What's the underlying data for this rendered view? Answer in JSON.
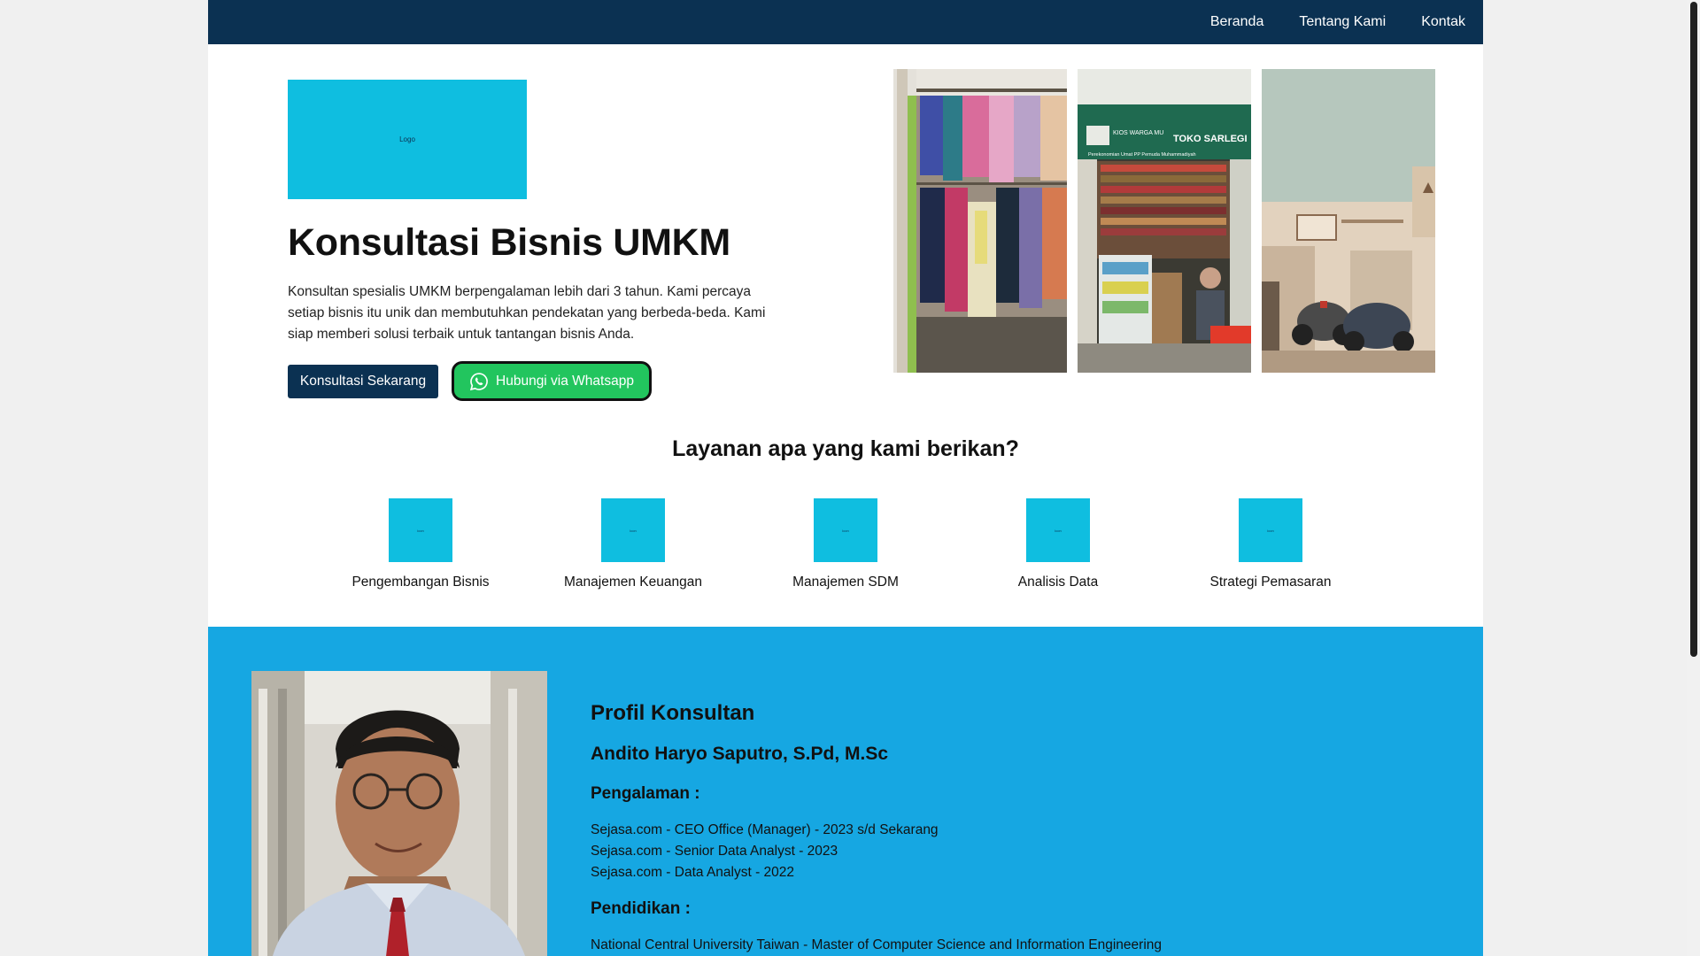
{
  "nav": {
    "links": [
      "Beranda",
      "Tentang Kami",
      "Kontak"
    ]
  },
  "hero": {
    "logo_text": "Logo",
    "title": "Konsultasi Bisnis UMKM",
    "description": "Konsultan spesialis UMKM berpengalaman lebih dari 3 tahun. Kami percaya setiap bisnis itu unik dan membutuhkan pendekatan yang berbeda-beda. Kami siap memberi solusi terbaik untuk tantangan bisnis Anda.",
    "primary_button": "Konsultasi Sekarang",
    "whatsapp_button": "Hubungi via Whatsapp",
    "photo_signs": [
      "KIOS WARGA MU",
      "TOKO SARLEGI",
      "Perekonomian Umat PP Pemuda Muhammadiyah"
    ]
  },
  "services": {
    "title": "Layanan apa yang kami berikan?",
    "icon_text": "icon",
    "items": [
      "Pengembangan Bisnis",
      "Manajemen Keuangan",
      "Manajemen SDM",
      "Analisis Data",
      "Strategi Pemasaran"
    ]
  },
  "profile": {
    "heading": "Profil Konsultan",
    "name": "Andito Haryo Saputro, S.Pd, M.Sc",
    "experience_heading": "Pengalaman :",
    "experience": [
      "Sejasa.com - CEO Office (Manager) - 2023 s/d Sekarang",
      "Sejasa.com - Senior Data Analyst - 2023",
      "Sejasa.com - Data Analyst - 2022"
    ],
    "education_heading": "Pendidikan :",
    "education": [
      "National Central University Taiwan - Master of Computer Science and Information Engineering"
    ]
  },
  "colors": {
    "navbar": "#0b3152",
    "accent": "#0fbee0",
    "profile_bg": "#16a7e2",
    "whatsapp": "#22c55e"
  }
}
